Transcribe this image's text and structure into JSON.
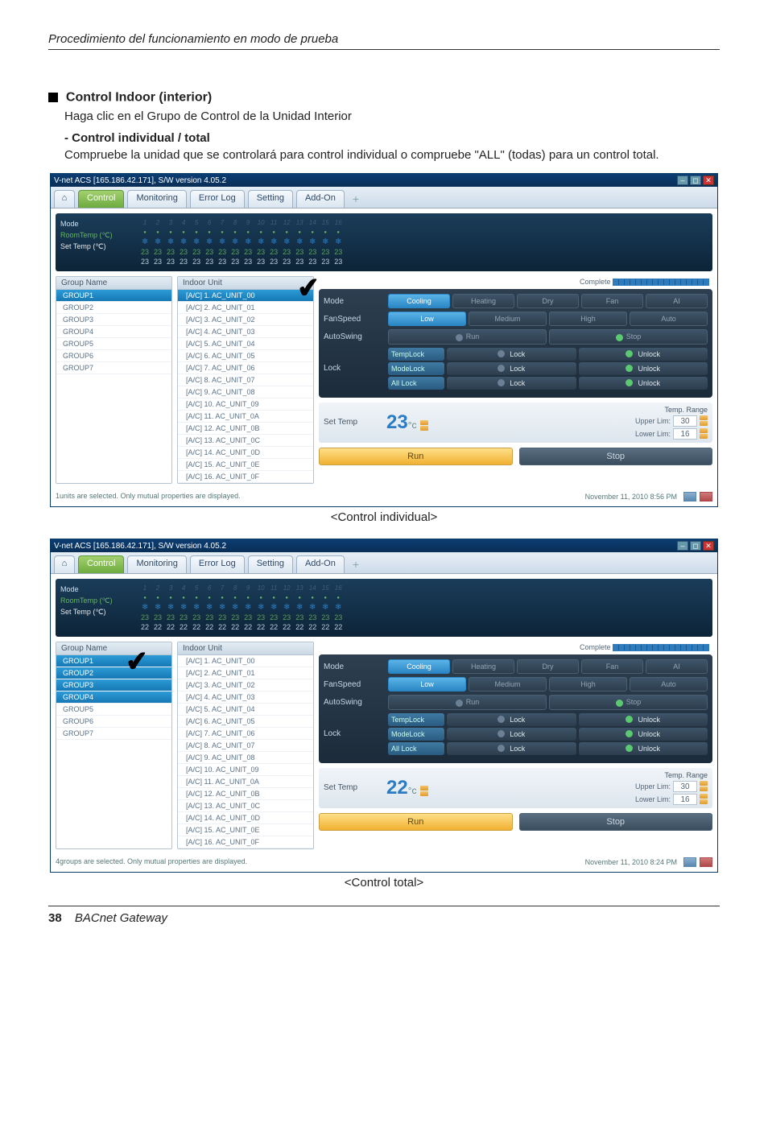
{
  "doc": {
    "header": "Procedimiento del funcionamiento en modo de prueba",
    "main_heading": "Control Indoor (interior)",
    "main_sub": "Haga clic en el Grupo de Control de la Unidad Interior",
    "sub_bold": "- Control individual / total",
    "sub_desc": "Compruebe la unidad que se controlará para control individual o compruebe \"ALL\" (todas) para un control total.",
    "caption1": "<Control individual>",
    "caption2": "<Control total>",
    "footer_page": "38",
    "footer_title": "BACnet Gateway"
  },
  "app1": {
    "title": "V-net ACS [165.186.42.171],   S/W version 4.05.2",
    "tabs": {
      "home": "⌂",
      "control": "Control",
      "monitoring": "Monitoring",
      "errorlog": "Error Log",
      "setting": "Setting",
      "addon": "Add-On",
      "plus": "+"
    },
    "overview": {
      "labels": {
        "mode": "Mode",
        "room": "RoomTemp (℃)",
        "set": "Set Temp   (℃)"
      },
      "room_val": "23",
      "set_val": "23",
      "cols": [
        "1",
        "2",
        "3",
        "4",
        "5",
        "6",
        "7",
        "8",
        "9",
        "10",
        "11",
        "12",
        "13",
        "14",
        "15",
        "16"
      ]
    },
    "group_head": "Group Name",
    "groups": [
      "GROUP1",
      "GROUP2",
      "GROUP3",
      "GROUP4",
      "GROUP5",
      "GROUP6",
      "GROUP7"
    ],
    "group_selected": 0,
    "unit_head": "Indoor Unit",
    "units": [
      "[A/C] 1. AC_UNIT_00",
      "[A/C] 2. AC_UNIT_01",
      "[A/C] 3. AC_UNIT_02",
      "[A/C] 4. AC_UNIT_03",
      "[A/C] 5. AC_UNIT_04",
      "[A/C] 6. AC_UNIT_05",
      "[A/C] 7. AC_UNIT_06",
      "[A/C] 8. AC_UNIT_07",
      "[A/C] 9. AC_UNIT_08",
      "[A/C] 10. AC_UNIT_09",
      "[A/C] 11. AC_UNIT_0A",
      "[A/C] 12. AC_UNIT_0B",
      "[A/C] 13. AC_UNIT_0C",
      "[A/C] 14. AC_UNIT_0D",
      "[A/C] 15. AC_UNIT_0E",
      "[A/C] 16. AC_UNIT_0F"
    ],
    "unit_selected": 0,
    "complete": "Complete",
    "ctrl": {
      "mode": {
        "label": "Mode",
        "opts": [
          "Cooling",
          "Heating",
          "Dry",
          "Fan",
          "AI"
        ],
        "sel": 0
      },
      "fan": {
        "label": "FanSpeed",
        "opts": [
          "Low",
          "Medium",
          "High",
          "Auto"
        ],
        "sel": 0
      },
      "swing": {
        "label": "AutoSwing",
        "run": "Run",
        "stop": "Stop"
      },
      "lock": {
        "label": "Lock",
        "rows": [
          {
            "name": "TempLock",
            "l": "Lock",
            "u": "Unlock"
          },
          {
            "name": "ModeLock",
            "l": "Lock",
            "u": "Unlock"
          },
          {
            "name": "All Lock",
            "l": "Lock",
            "u": "Unlock"
          }
        ]
      },
      "settemp": {
        "title": "Set Temp",
        "val": "23",
        "unit": "°c",
        "range_title": "Temp. Range",
        "upper_l": "Upper Lim:",
        "upper_v": "30",
        "lower_l": "Lower Lim:",
        "lower_v": "16"
      },
      "run": "Run",
      "stop": "Stop"
    },
    "status_left": "1units are selected. Only mutual properties are displayed.",
    "status_right": "November 11, 2010  8:56 PM"
  },
  "app2": {
    "title": "V-net ACS [165.186.42.171],   S/W version 4.05.2",
    "tabs": {
      "home": "⌂",
      "control": "Control",
      "monitoring": "Monitoring",
      "errorlog": "Error Log",
      "setting": "Setting",
      "addon": "Add-On",
      "plus": "+"
    },
    "overview": {
      "labels": {
        "mode": "Mode",
        "room": "RoomTemp (℃)",
        "set": "Set Temp   (℃)"
      },
      "room_val": "23",
      "set_val": "22",
      "cols": [
        "1",
        "2",
        "3",
        "4",
        "5",
        "6",
        "7",
        "8",
        "9",
        "10",
        "11",
        "12",
        "13",
        "14",
        "15",
        "16"
      ]
    },
    "group_head": "Group Name",
    "groups": [
      "GROUP1",
      "GROUP2",
      "GROUP3",
      "GROUP4",
      "GROUP5",
      "GROUP6",
      "GROUP7"
    ],
    "groups_selected": [
      0,
      1,
      2,
      3
    ],
    "unit_head": "Indoor Unit",
    "units": [
      "[A/C] 1. AC_UNIT_00",
      "[A/C] 2. AC_UNIT_01",
      "[A/C] 3. AC_UNIT_02",
      "[A/C] 4. AC_UNIT_03",
      "[A/C] 5. AC_UNIT_04",
      "[A/C] 6. AC_UNIT_05",
      "[A/C] 7. AC_UNIT_06",
      "[A/C] 8. AC_UNIT_07",
      "[A/C] 9. AC_UNIT_08",
      "[A/C] 10. AC_UNIT_09",
      "[A/C] 11. AC_UNIT_0A",
      "[A/C] 12. AC_UNIT_0B",
      "[A/C] 13. AC_UNIT_0C",
      "[A/C] 14. AC_UNIT_0D",
      "[A/C] 15. AC_UNIT_0E",
      "[A/C] 16. AC_UNIT_0F"
    ],
    "complete": "Complete",
    "ctrl": {
      "mode": {
        "label": "Mode",
        "opts": [
          "Cooling",
          "Heating",
          "Dry",
          "Fan",
          "AI"
        ],
        "sel": 0
      },
      "fan": {
        "label": "FanSpeed",
        "opts": [
          "Low",
          "Medium",
          "High",
          "Auto"
        ],
        "sel": 0
      },
      "swing": {
        "label": "AutoSwing",
        "run": "Run",
        "stop": "Stop"
      },
      "lock": {
        "label": "Lock",
        "rows": [
          {
            "name": "TempLock",
            "l": "Lock",
            "u": "Unlock"
          },
          {
            "name": "ModeLock",
            "l": "Lock",
            "u": "Unlock"
          },
          {
            "name": "All Lock",
            "l": "Lock",
            "u": "Unlock"
          }
        ]
      },
      "settemp": {
        "title": "Set Temp",
        "val": "22",
        "unit": "°c",
        "range_title": "Temp. Range",
        "upper_l": "Upper Lim:",
        "upper_v": "30",
        "lower_l": "Lower Lim:",
        "lower_v": "16"
      },
      "run": "Run",
      "stop": "Stop"
    },
    "status_left": "4groups are selected. Only mutual properties are displayed.",
    "status_right": "November 11, 2010  8:24 PM"
  }
}
